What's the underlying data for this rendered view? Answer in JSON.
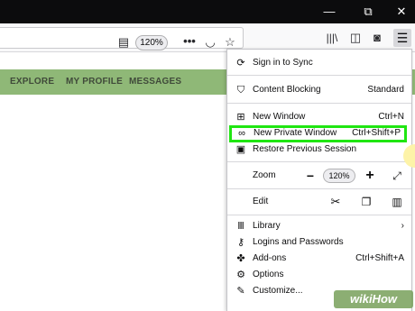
{
  "window": {
    "minimize_glyph": "—",
    "maximize_glyph": "⧉",
    "close_glyph": "✕"
  },
  "toolbar": {
    "zoom_badge": "120%",
    "icons": [
      "reader-view-icon",
      "more-icon",
      "pocket-icon",
      "bookmark-star-icon",
      "library-icon",
      "sidebar-icon",
      "account-icon",
      "hamburger-menu-icon"
    ]
  },
  "site_nav": {
    "links": [
      "EXPLORE",
      "MY PROFILE",
      "MESSAGES"
    ],
    "bar_color": "#8fb877"
  },
  "app_menu": {
    "sign_in": "Sign in to Sync",
    "content_blocking": {
      "label": "Content Blocking",
      "value": "Standard"
    },
    "new_window": {
      "label": "New Window",
      "shortcut": "Ctrl+N"
    },
    "new_private_window": {
      "label": "New Private Window",
      "shortcut": "Ctrl+Shift+P",
      "highlight_color": "#20e612"
    },
    "restore_session": "Restore Previous Session",
    "zoom": {
      "label": "Zoom",
      "value": "120%",
      "minus": "−",
      "plus": "+"
    },
    "edit": {
      "label": "Edit"
    },
    "library": "Library",
    "logins": "Logins and Passwords",
    "addons": {
      "label": "Add-ons",
      "shortcut": "Ctrl+Shift+A"
    },
    "options": "Options",
    "customize": "Customize..."
  },
  "watermark": "wikiHow"
}
